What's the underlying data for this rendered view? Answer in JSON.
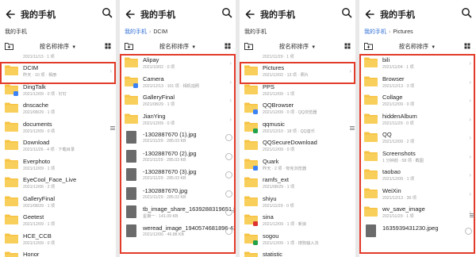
{
  "colors": {
    "accent": "#2f6fd6",
    "folder": "#f7c343",
    "highlight": "#e23b2a"
  },
  "title": "我的手机",
  "sort_label": "按名称排序",
  "panels": [
    {
      "crumbs": [
        "我的手机"
      ],
      "rows": [
        {
          "type": "meta-only",
          "name": "",
          "meta": "2021/11/13 · 1 项",
          "partial": true
        },
        {
          "type": "folder",
          "name": "DCIM",
          "meta": "昨天 · 10 项 · 相册",
          "selected": true,
          "chev": true
        },
        {
          "type": "folder",
          "name": "DingTalk",
          "meta": "2021/12/09 · 0 项 · 钉钉",
          "badge": "blue"
        },
        {
          "type": "folder",
          "name": "dnscache",
          "meta": "2021/08/29 · 1 项"
        },
        {
          "type": "folder",
          "name": "documents",
          "meta": "2021/12/09 · 0 项"
        },
        {
          "type": "folder",
          "name": "Download",
          "meta": "2021/11/26 · 4 项 · 下载目录"
        },
        {
          "type": "folder",
          "name": "Everphoto",
          "meta": "2021/12/09 · 1 项"
        },
        {
          "type": "folder",
          "name": "EyeCool_Face_Live",
          "meta": "2021/12/06 · 2 项"
        },
        {
          "type": "folder",
          "name": "GalleryFinal",
          "meta": "2021/08/29 · 1 项"
        },
        {
          "type": "folder",
          "name": "Geetest",
          "meta": "2021/12/09 · 1 项"
        },
        {
          "type": "folder",
          "name": "HCE_CCB",
          "meta": "2021/12/09 · 0 项"
        },
        {
          "type": "folder",
          "name": "Honor",
          "meta": "",
          "partial": true
        }
      ]
    },
    {
      "crumbs": [
        "我的手机",
        "DCIM"
      ],
      "rows": [
        {
          "type": "folder",
          "name": "Alipay",
          "meta": "2021/10/02 · 0 项",
          "chev": true
        },
        {
          "type": "folder",
          "name": "Camera",
          "meta": "2021/12/13 · 101 项 · 相机拍照",
          "chev": true,
          "badge": "blue"
        },
        {
          "type": "folder",
          "name": "GalleryFinal",
          "meta": "2021/08/29 · 1 项",
          "chev": true
        },
        {
          "type": "folder",
          "name": "JianYing",
          "meta": "2021/12/09 · 0 项",
          "chev": true
        },
        {
          "type": "image",
          "name": "-1302887670 (1).jpg",
          "meta": "2021/11/29 · 285.03 KB",
          "check": true
        },
        {
          "type": "image",
          "name": "-1302887670 (2).jpg",
          "meta": "2021/11/29 · 285.03 KB",
          "check": true
        },
        {
          "type": "image",
          "name": "-1302887670 (3).jpg",
          "meta": "2021/11/29 · 285.03 KB",
          "check": true
        },
        {
          "type": "image",
          "name": "-1302887670.jpg",
          "meta": "2021/11/29 · 285.03 KB",
          "check": true
        },
        {
          "type": "image",
          "name": "tb_image_share_1639288319651.jpg",
          "meta": "星期一 · 141.09 KB",
          "check": true
        },
        {
          "type": "image",
          "name": "weread_image_1940574681896 43.jpeg",
          "meta": "2021/12/06 · 46.88 KB",
          "check": true
        }
      ]
    },
    {
      "crumbs": [
        "我的手机"
      ],
      "rows": [
        {
          "type": "meta-only",
          "name": "",
          "meta": "2021/11/29 · 1 项",
          "partial": true
        },
        {
          "type": "folder",
          "name": "Pictures",
          "meta": "2021/12/02 · 13 项 · 照片",
          "selected": true,
          "chev": true
        },
        {
          "type": "folder",
          "name": "PPS",
          "meta": "2021/12/09 · 1 项"
        },
        {
          "type": "folder",
          "name": "QQBrowser",
          "meta": "2021/12/09 · 0 项 · QQ浏览器",
          "badge": "blue"
        },
        {
          "type": "folder",
          "name": "qqmusic",
          "meta": "2021/12/10 · 18 项 · QQ音乐",
          "badge": "green"
        },
        {
          "type": "folder",
          "name": "QQSecureDownload",
          "meta": "2021/12/09 · 0 项"
        },
        {
          "type": "folder",
          "name": "Quark",
          "meta": "昨天 · 2 项 · 夸克浏览器",
          "badge": "blue"
        },
        {
          "type": "folder",
          "name": "ramfs_ext",
          "meta": "2021/08/29 · 1 项"
        },
        {
          "type": "folder",
          "name": "shiyu",
          "meta": "2021/11/29 · 0 项"
        },
        {
          "type": "folder",
          "name": "sina",
          "meta": "2021/12/09 · 1 项 · 新浪",
          "badge": "red"
        },
        {
          "type": "folder",
          "name": "sogou",
          "meta": "2021/12/09 · 1 项 · 搜狗输入法",
          "badge": "green"
        },
        {
          "type": "folder",
          "name": "statistic",
          "meta": "",
          "partial": true
        }
      ]
    },
    {
      "crumbs": [
        "我的手机",
        "Pictures"
      ],
      "rows": [
        {
          "type": "folder",
          "name": "bili",
          "meta": "2021/11/04 · 1 项",
          "chev": true
        },
        {
          "type": "folder",
          "name": "Browser",
          "meta": "2021/12/13 · 3 项",
          "chev": true
        },
        {
          "type": "folder",
          "name": "Collage",
          "meta": "2021/12/09 · 0 项",
          "chev": true
        },
        {
          "type": "folder",
          "name": "hiddenAlbum",
          "meta": "2021/11/29 · 0 项",
          "chev": true
        },
        {
          "type": "folder",
          "name": "QQ",
          "meta": "2021/12/09 · 2 项",
          "chev": true
        },
        {
          "type": "folder",
          "name": "Screenshots",
          "meta": "1 分钟前 · 58 项 · 截图",
          "chev": true
        },
        {
          "type": "folder",
          "name": "taobao",
          "meta": "2021/12/09 · 1 项",
          "chev": true
        },
        {
          "type": "folder",
          "name": "WeiXin",
          "meta": "2021/12/13 · 36 项",
          "chev": true
        },
        {
          "type": "folder",
          "name": "wv_save_image",
          "meta": "2021/11/29 · 1 项",
          "chev": true
        },
        {
          "type": "image",
          "name": "1635939431230.jpeg",
          "meta": "",
          "check": true,
          "partial": true
        }
      ]
    }
  ]
}
